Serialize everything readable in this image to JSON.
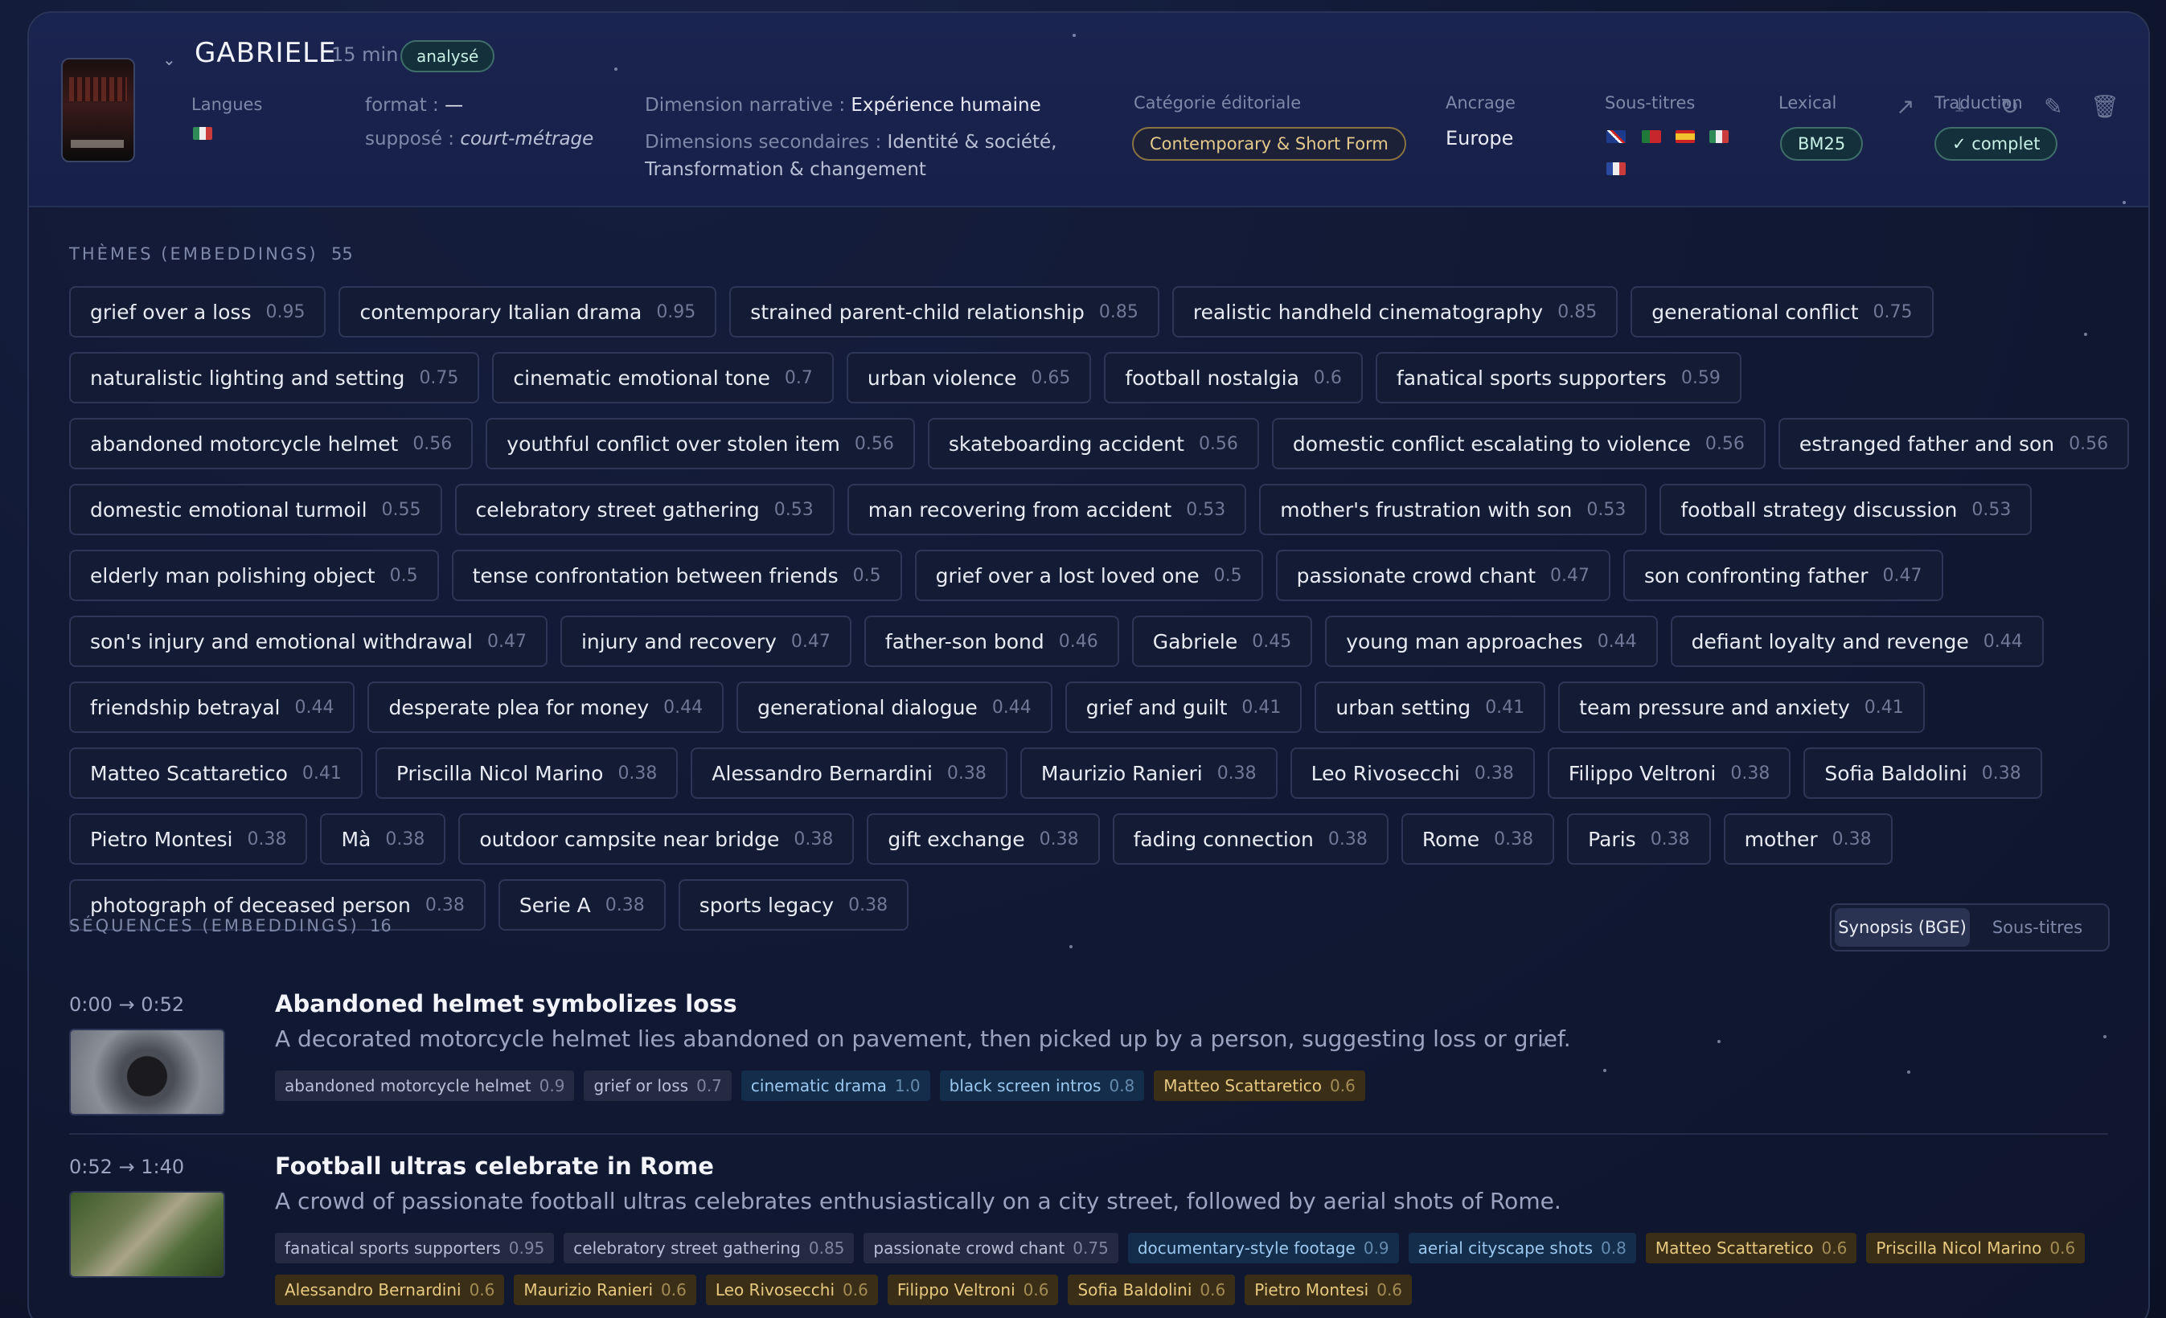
{
  "header": {
    "title": "GABRIELE",
    "duration": "15 min",
    "status_badge": "analysé",
    "langues_label": "Langues",
    "format_label": "format :",
    "format_value": "—",
    "suppose_label": "supposé :",
    "suppose_value": "court-métrage",
    "narrative_label": "Dimension narrative :",
    "narrative_value": "Expérience humaine",
    "secondary_label": "Dimensions secondaires :",
    "secondary_value_1": "Identité & société,",
    "secondary_value_2": "Transformation & changement",
    "category_label": "Catégorie éditoriale",
    "category_value": "Contemporary & Short Form",
    "ancrage_label": "Ancrage",
    "ancrage_value": "Europe",
    "subtitles_label": "Sous-titres",
    "lexical_label": "Lexical",
    "lexical_value": "BM25",
    "translation_label": "Traduction",
    "translation_value": "✓ complet"
  },
  "themes": {
    "title": "THÈMES (EMBEDDINGS)",
    "count": "55",
    "items": [
      {
        "label": "grief over a loss",
        "score": "0.95"
      },
      {
        "label": "contemporary Italian drama",
        "score": "0.95"
      },
      {
        "label": "strained parent-child relationship",
        "score": "0.85"
      },
      {
        "label": "realistic handheld cinematography",
        "score": "0.85"
      },
      {
        "label": "generational conflict",
        "score": "0.75"
      },
      {
        "label": "naturalistic lighting and setting",
        "score": "0.75"
      },
      {
        "label": "cinematic emotional tone",
        "score": "0.7"
      },
      {
        "label": "urban violence",
        "score": "0.65"
      },
      {
        "label": "football nostalgia",
        "score": "0.6"
      },
      {
        "label": "fanatical sports supporters",
        "score": "0.59"
      },
      {
        "label": "abandoned motorcycle helmet",
        "score": "0.56"
      },
      {
        "label": "youthful conflict over stolen item",
        "score": "0.56"
      },
      {
        "label": "skateboarding accident",
        "score": "0.56"
      },
      {
        "label": "domestic conflict escalating to violence",
        "score": "0.56"
      },
      {
        "label": "estranged father and son",
        "score": "0.56"
      },
      {
        "label": "domestic emotional turmoil",
        "score": "0.55"
      },
      {
        "label": "celebratory street gathering",
        "score": "0.53"
      },
      {
        "label": "man recovering from accident",
        "score": "0.53"
      },
      {
        "label": "mother's frustration with son",
        "score": "0.53"
      },
      {
        "label": "football strategy discussion",
        "score": "0.53"
      },
      {
        "label": "elderly man polishing object",
        "score": "0.5"
      },
      {
        "label": "tense confrontation between friends",
        "score": "0.5"
      },
      {
        "label": "grief over a lost loved one",
        "score": "0.5"
      },
      {
        "label": "passionate crowd chant",
        "score": "0.47"
      },
      {
        "label": "son confronting father",
        "score": "0.47"
      },
      {
        "label": "son's injury and emotional withdrawal",
        "score": "0.47"
      },
      {
        "label": "injury and recovery",
        "score": "0.47"
      },
      {
        "label": "father-son bond",
        "score": "0.46"
      },
      {
        "label": "Gabriele",
        "score": "0.45"
      },
      {
        "label": "young man approaches",
        "score": "0.44"
      },
      {
        "label": "defiant loyalty and revenge",
        "score": "0.44"
      },
      {
        "label": "friendship betrayal",
        "score": "0.44"
      },
      {
        "label": "desperate plea for money",
        "score": "0.44"
      },
      {
        "label": "generational dialogue",
        "score": "0.44"
      },
      {
        "label": "grief and guilt",
        "score": "0.41"
      },
      {
        "label": "urban setting",
        "score": "0.41"
      },
      {
        "label": "team pressure and anxiety",
        "score": "0.41"
      },
      {
        "label": "Matteo Scattaretico",
        "score": "0.41"
      },
      {
        "label": "Priscilla Nicol Marino",
        "score": "0.38"
      },
      {
        "label": "Alessandro Bernardini",
        "score": "0.38"
      },
      {
        "label": "Maurizio Ranieri",
        "score": "0.38"
      },
      {
        "label": "Leo Rivosecchi",
        "score": "0.38"
      },
      {
        "label": "Filippo Veltroni",
        "score": "0.38"
      },
      {
        "label": "Sofia Baldolini",
        "score": "0.38"
      },
      {
        "label": "Pietro Montesi",
        "score": "0.38"
      },
      {
        "label": "Mà",
        "score": "0.38"
      },
      {
        "label": "outdoor campsite near bridge",
        "score": "0.38"
      },
      {
        "label": "gift exchange",
        "score": "0.38"
      },
      {
        "label": "fading connection",
        "score": "0.38"
      },
      {
        "label": "Rome",
        "score": "0.38"
      },
      {
        "label": "Paris",
        "score": "0.38"
      },
      {
        "label": "mother",
        "score": "0.38"
      },
      {
        "label": "photograph of deceased person",
        "score": "0.38"
      },
      {
        "label": "Serie A",
        "score": "0.38"
      },
      {
        "label": "sports legacy",
        "score": "0.38"
      }
    ]
  },
  "sequences": {
    "title": "SÉQUENCES (EMBEDDINGS)",
    "count": "16",
    "toggle": [
      "Synopsis (BGE)",
      "Sous-titres"
    ],
    "items": [
      {
        "time": "0:00 → 0:52",
        "title": "Abandoned helmet symbolizes loss",
        "desc": "A decorated motorcycle helmet lies abandoned on pavement, then picked up by a person, suggesting loss or grief.",
        "chips": [
          {
            "label": "abandoned motorcycle helmet",
            "score": "0.9",
            "kind": "g"
          },
          {
            "label": "grief or loss",
            "score": "0.7",
            "kind": "g"
          },
          {
            "label": "cinematic drama",
            "score": "1.0",
            "kind": "b"
          },
          {
            "label": "black screen intros",
            "score": "0.8",
            "kind": "b"
          },
          {
            "label": "Matteo Scattaretico",
            "score": "0.6",
            "kind": "y"
          }
        ]
      },
      {
        "time": "0:52 → 1:40",
        "title": "Football ultras celebrate in Rome",
        "desc": "A crowd of passionate football ultras celebrates enthusiastically on a city street, followed by aerial shots of Rome.",
        "chips": [
          {
            "label": "fanatical sports supporters",
            "score": "0.95",
            "kind": "g"
          },
          {
            "label": "celebratory street gathering",
            "score": "0.85",
            "kind": "g"
          },
          {
            "label": "passionate crowd chant",
            "score": "0.75",
            "kind": "g"
          },
          {
            "label": "documentary-style footage",
            "score": "0.9",
            "kind": "b"
          },
          {
            "label": "aerial cityscape shots",
            "score": "0.8",
            "kind": "b"
          },
          {
            "label": "Matteo Scattaretico",
            "score": "0.6",
            "kind": "y"
          },
          {
            "label": "Priscilla Nicol Marino",
            "score": "0.6",
            "kind": "y"
          },
          {
            "label": "Alessandro Bernardini",
            "score": "0.6",
            "kind": "y"
          },
          {
            "label": "Maurizio Ranieri",
            "score": "0.6",
            "kind": "y"
          },
          {
            "label": "Leo Rivosecchi",
            "score": "0.6",
            "kind": "y"
          },
          {
            "label": "Filippo Veltroni",
            "score": "0.6",
            "kind": "y"
          },
          {
            "label": "Sofia Baldolini",
            "score": "0.6",
            "kind": "y"
          },
          {
            "label": "Pietro Montesi",
            "score": "0.6",
            "kind": "y"
          }
        ]
      }
    ]
  },
  "icons": [
    "chevron-down-icon",
    "external-link-icon",
    "download-icon",
    "refresh-icon",
    "edit-icon",
    "trash-icon"
  ]
}
